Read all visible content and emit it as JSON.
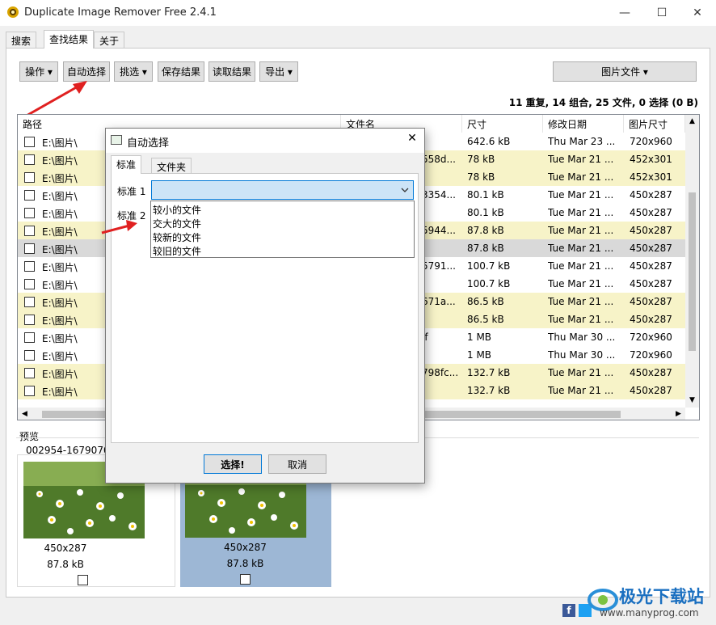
{
  "window": {
    "title": "Duplicate Image Remover Free 2.4.1",
    "minimize": "—",
    "maximize": "☐",
    "close": "✕"
  },
  "tabs": [
    "搜索",
    "查找结果",
    "关于"
  ],
  "toolbar": {
    "actions": "操作 ▾",
    "auto_select": "自动选择",
    "filter": "挑选 ▾",
    "save": "保存结果",
    "load": "读取结果",
    "export": "导出 ▾",
    "image_files": "图片文件 ▾"
  },
  "stats": "11 重复, 14 组合, 25 文件, 0 选择 (0 B)",
  "grid": {
    "headers": [
      "路径",
      "文件名",
      "尺寸",
      "修改日期",
      "图片尺寸"
    ],
    "rows": [
      {
        "path": "E:\\图片\\",
        "file": "",
        "size": "642.6 kB",
        "date": "Thu Mar 23 ...",
        "dims": "720x960",
        "hl": false,
        "sel": false
      },
      {
        "path": "E:\\图片\\",
        "file": "558d...",
        "size": "78 kB",
        "date": "Tue Mar 21 ...",
        "dims": "452x301",
        "hl": true,
        "sel": false
      },
      {
        "path": "E:\\图片\\",
        "file": "",
        "size": "78 kB",
        "date": "Tue Mar 21 ...",
        "dims": "452x301",
        "hl": true,
        "sel": false
      },
      {
        "path": "E:\\图片\\",
        "file": "3354...",
        "size": "80.1 kB",
        "date": "Tue Mar 21 ...",
        "dims": "450x287",
        "hl": false,
        "sel": false
      },
      {
        "path": "E:\\图片\\",
        "file": "",
        "size": "80.1 kB",
        "date": "Tue Mar 21 ...",
        "dims": "450x287",
        "hl": false,
        "sel": false
      },
      {
        "path": "E:\\图片\\",
        "file": "5944...",
        "size": "87.8 kB",
        "date": "Tue Mar 21 ...",
        "dims": "450x287",
        "hl": true,
        "sel": false
      },
      {
        "path": "E:\\图片\\",
        "file": "",
        "size": "87.8 kB",
        "date": "Tue Mar 21 ...",
        "dims": "450x287",
        "hl": false,
        "sel": true
      },
      {
        "path": "E:\\图片\\",
        "file": "5791...",
        "size": "100.7 kB",
        "date": "Tue Mar 21 ...",
        "dims": "450x287",
        "hl": false,
        "sel": false
      },
      {
        "path": "E:\\图片\\",
        "file": "",
        "size": "100.7 kB",
        "date": "Tue Mar 21 ...",
        "dims": "450x287",
        "hl": false,
        "sel": false
      },
      {
        "path": "E:\\图片\\",
        "file": "671a...",
        "size": "86.5 kB",
        "date": "Tue Mar 21 ...",
        "dims": "450x287",
        "hl": true,
        "sel": false
      },
      {
        "path": "E:\\图片\\",
        "file": "",
        "size": "86.5 kB",
        "date": "Tue Mar 21 ...",
        "dims": "450x287",
        "hl": true,
        "sel": false
      },
      {
        "path": "E:\\图片\\",
        "file": "if",
        "size": "1 MB",
        "date": "Thu Mar 30 ...",
        "dims": "720x960",
        "hl": false,
        "sel": false
      },
      {
        "path": "E:\\图片\\",
        "file": "",
        "size": "1 MB",
        "date": "Thu Mar 30 ...",
        "dims": "720x960",
        "hl": false,
        "sel": false
      },
      {
        "path": "E:\\图片\\",
        "file": "798fc...",
        "size": "132.7 kB",
        "date": "Tue Mar 21 ...",
        "dims": "450x287",
        "hl": true,
        "sel": false
      },
      {
        "path": "E:\\图片\\",
        "file": "",
        "size": "132.7 kB",
        "date": "Tue Mar 21 ...",
        "dims": "450x287",
        "hl": true,
        "sel": false
      }
    ]
  },
  "preview": {
    "label": "预览",
    "group_name": "002954-16790705",
    "cards": [
      {
        "dims": "450x287",
        "size": "87.8 kB"
      },
      {
        "dims": "450x287",
        "size": "87.8 kB"
      }
    ]
  },
  "dialog": {
    "title": "自动选择",
    "close": "✕",
    "tabs": [
      "标准",
      "文件夹"
    ],
    "criterion1_label": "标准 1",
    "criterion2_label": "标准 2",
    "options": [
      "较小的文件",
      "交大的文件",
      "较新的文件",
      "较旧的文件"
    ],
    "select_button": "选择!",
    "cancel_button": "取消"
  },
  "watermark": {
    "brand": "极光下载站",
    "url": "www.manyprog.com"
  },
  "colors": {
    "highlight_row": "#f7f3c8",
    "selected_row": "#d9d9d9",
    "selected_card": "#9db7d5",
    "accent": "#0078d7"
  }
}
